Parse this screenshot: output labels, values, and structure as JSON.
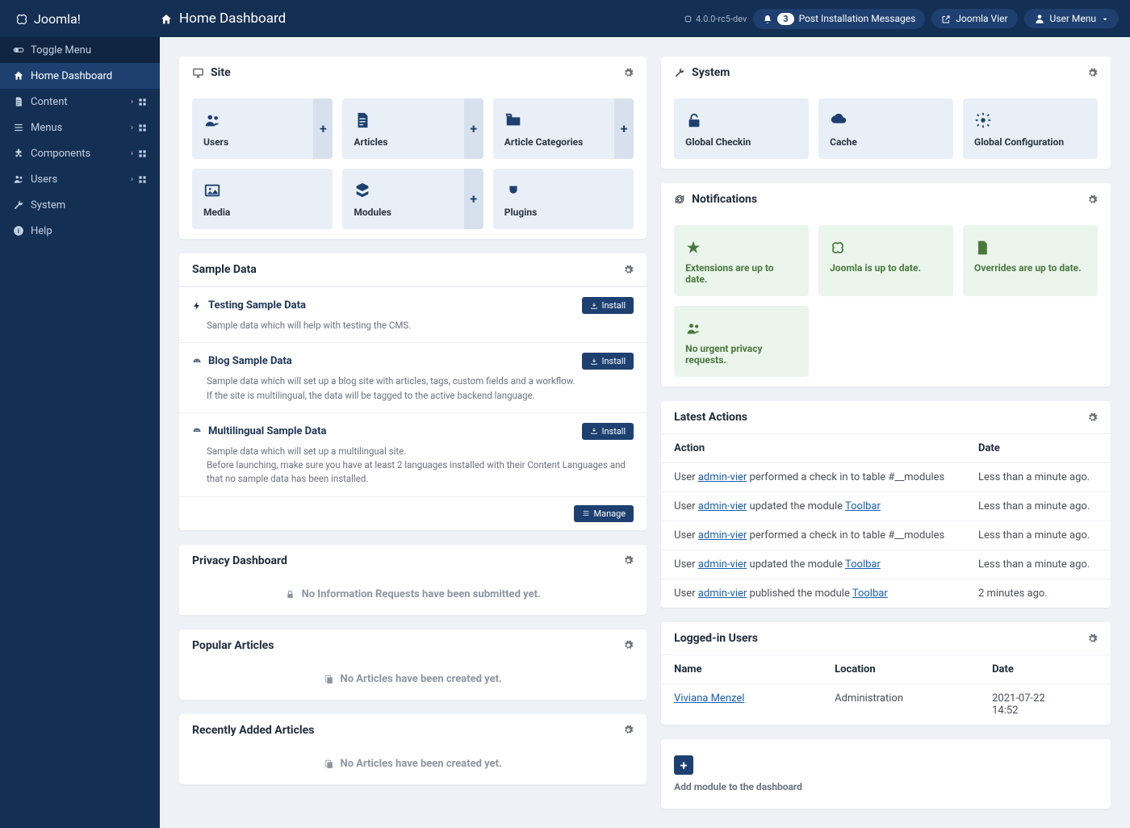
{
  "brand": "Joomla!",
  "page_title": "Home Dashboard",
  "version": "4.0.0-rc5-dev",
  "header": {
    "post_install_count": "3",
    "post_install_label": "Post Installation Messages",
    "site_name": "Joomla Vier",
    "user_menu": "User Menu"
  },
  "sidebar": {
    "toggle": "Toggle Menu",
    "items": [
      {
        "label": "Home Dashboard"
      },
      {
        "label": "Content"
      },
      {
        "label": "Menus"
      },
      {
        "label": "Components"
      },
      {
        "label": "Users"
      },
      {
        "label": "System"
      },
      {
        "label": "Help"
      }
    ]
  },
  "site_panel": {
    "title": "Site",
    "cards": [
      {
        "label": "Users",
        "plus": true
      },
      {
        "label": "Articles",
        "plus": true
      },
      {
        "label": "Article Categories",
        "plus": true
      },
      {
        "label": "Media",
        "plus": false
      },
      {
        "label": "Modules",
        "plus": true
      },
      {
        "label": "Plugins",
        "plus": false
      }
    ]
  },
  "sample_panel": {
    "title": "Sample Data",
    "install_label": "Install",
    "manage_label": "Manage",
    "items": [
      {
        "title": "Testing Sample Data",
        "desc": "Sample data which will help with testing the CMS."
      },
      {
        "title": "Blog Sample Data",
        "desc": "Sample data which will set up a blog site with articles, tags, custom fields and a workflow.\nIf the site is multilingual, the data will be tagged to the active backend language."
      },
      {
        "title": "Multilingual Sample Data",
        "desc": "Sample data which will set up a multilingual site.\nBefore launching, make sure you have at least 2 languages installed with their Content Languages and that no sample data has been installed."
      }
    ]
  },
  "privacy_panel": {
    "title": "Privacy Dashboard",
    "empty": "No Information Requests have been submitted yet."
  },
  "popular_panel": {
    "title": "Popular Articles",
    "empty": "No Articles have been created yet."
  },
  "recent_panel": {
    "title": "Recently Added Articles",
    "empty": "No Articles have been created yet."
  },
  "system_panel": {
    "title": "System",
    "cards": [
      {
        "label": "Global Checkin"
      },
      {
        "label": "Cache"
      },
      {
        "label": "Global Configuration"
      }
    ]
  },
  "notifications_panel": {
    "title": "Notifications",
    "items": [
      {
        "label": "Extensions are up to date."
      },
      {
        "label": "Joomla is up to date."
      },
      {
        "label": "Overrides are up to date."
      },
      {
        "label": "No urgent privacy requests."
      }
    ]
  },
  "actions_panel": {
    "title": "Latest Actions",
    "col_action": "Action",
    "col_date": "Date",
    "rows": [
      {
        "prefix": "User ",
        "user": "admin-vier",
        "mid": " performed a check in to table #__modules",
        "link": "",
        "date": "Less than a minute ago."
      },
      {
        "prefix": "User ",
        "user": "admin-vier",
        "mid": " updated the module ",
        "link": "Toolbar",
        "date": "Less than a minute ago."
      },
      {
        "prefix": "User ",
        "user": "admin-vier",
        "mid": " performed a check in to table #__modules",
        "link": "",
        "date": "Less than a minute ago."
      },
      {
        "prefix": "User ",
        "user": "admin-vier",
        "mid": " updated the module ",
        "link": "Toolbar",
        "date": "Less than a minute ago."
      },
      {
        "prefix": "User ",
        "user": "admin-vier",
        "mid": " published the module ",
        "link": "Toolbar",
        "date": "2 minutes ago."
      }
    ]
  },
  "logged_panel": {
    "title": "Logged-in Users",
    "col_name": "Name",
    "col_location": "Location",
    "col_date": "Date",
    "rows": [
      {
        "name": "Viviana Menzel",
        "location": "Administration",
        "date": "2021-07-22 14:52"
      }
    ]
  },
  "add_module": "Add module to the dashboard"
}
